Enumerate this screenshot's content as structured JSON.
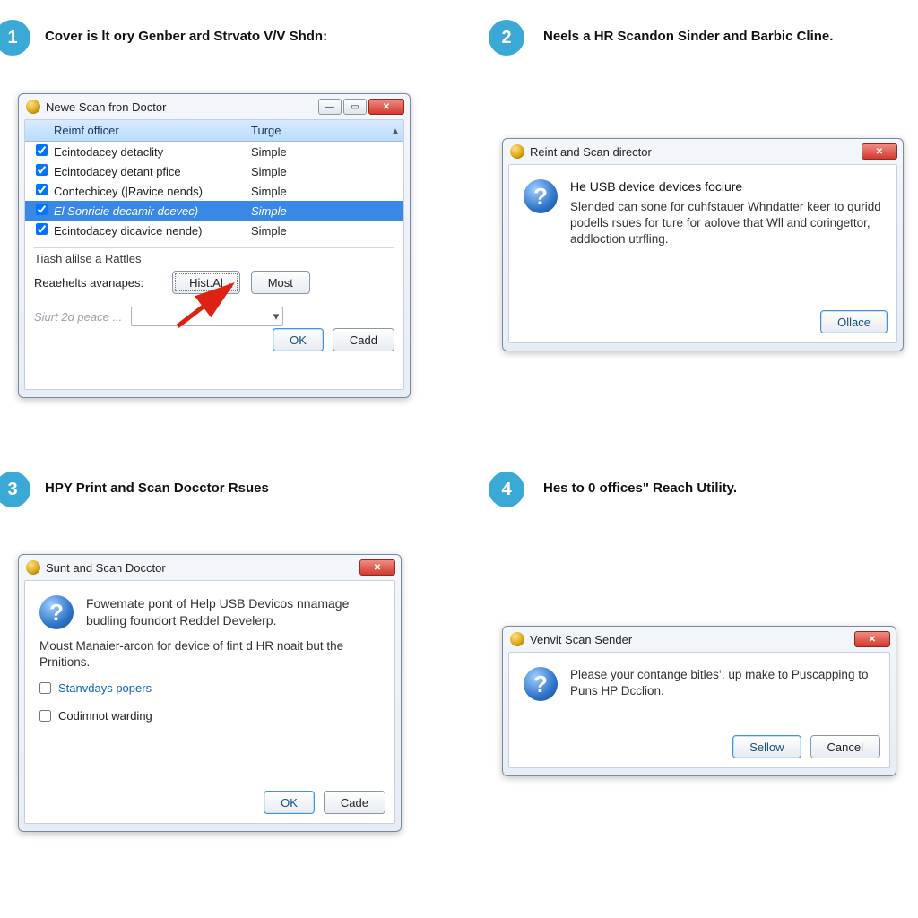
{
  "steps": {
    "s1": {
      "num": "1",
      "label": "Cover is lt ory Genber ard Strvato V/V Shdn:"
    },
    "s2": {
      "num": "2",
      "label": "Neels a HR Scandon Sinder and Barbic Cline."
    },
    "s3": {
      "num": "3",
      "label": "HPY Print and Scan Docctor Rsues"
    },
    "s4": {
      "num": "4",
      "label": "Hes to 0 offices\" Reach Utility."
    }
  },
  "panel1": {
    "title": "Newe Scan fron Doctor",
    "columns": {
      "c1": "Reimf officer",
      "c2": "Turge"
    },
    "rows": [
      {
        "name": "Ecintodacey detaclity",
        "type": "Simple",
        "checked": true,
        "sel": false
      },
      {
        "name": "Ecintodacey detant pfice",
        "type": "Simple",
        "checked": true,
        "sel": false
      },
      {
        "name": "Contechicey (|Ravice nends)",
        "type": "Simple",
        "checked": true,
        "sel": false
      },
      {
        "name": "El Sonricie decamir dcevec)",
        "type": "Simple",
        "checked": true,
        "sel": true
      },
      {
        "name": "Ecintodacey dicavice nende)",
        "type": "Simple",
        "checked": true,
        "sel": false
      }
    ],
    "group_title": "Tiash alilse a Rattles",
    "group_sub": "Reaehelts avanapes:",
    "btn_histal": "Hist.Al",
    "btn_most": "Most",
    "combo_label": "Siurt 2d peace ...",
    "ok": "OK",
    "cadd": "Cadd"
  },
  "panel2": {
    "title": "Reint and Scan director",
    "headline": "He USB device devices fociure",
    "body": "Slended can sone for cuhfstauer Whndatter keer to quridd podells rsues for ture for aolove that Wll and coringettor, addloction utrfling.",
    "ok": "Ollace"
  },
  "panel3": {
    "title": "Sunt and Scan Docctor",
    "headline": "Fowemate pont of Help USB Devicos nnamage budling foundort Reddel Develerp.",
    "body": "Moust Manaier-arcon for device of fint d HR noait but the Prnitions.",
    "chk1": "Stanvdays popers",
    "chk2": "Codimnot warding",
    "ok": "OK",
    "cancel": "Cade"
  },
  "panel4": {
    "title": "Venvit Scan Sender",
    "body": "Please your contange bitles‛. up make to Puscapping to Puns HP Dcclion.",
    "ok": "Sellow",
    "cancel": "Cancel"
  }
}
